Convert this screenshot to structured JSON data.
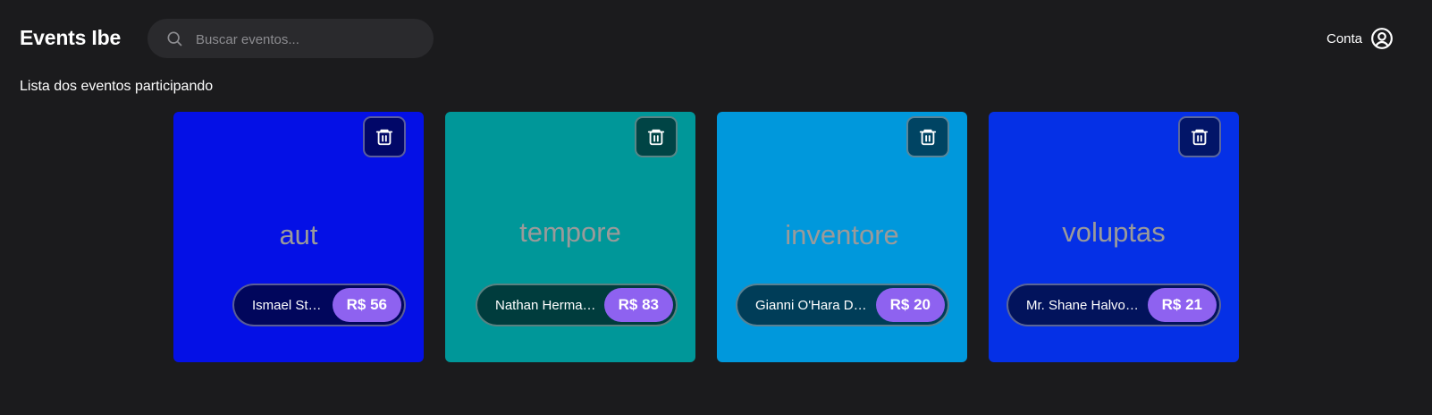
{
  "header": {
    "brand": "Events Ibe",
    "search": {
      "placeholder": "Buscar eventos...",
      "value": ""
    },
    "account_label": "Conta"
  },
  "main": {
    "subtitle": "Lista dos eventos participando"
  },
  "cards": [
    {
      "title": "aut",
      "organizer": "Ismael Stehr",
      "price": "R$ 56",
      "color": "#0410e6"
    },
    {
      "title": "tempore",
      "organizer": "Nathan Hermann",
      "price": "R$ 83",
      "color": "#009799"
    },
    {
      "title": "inventore",
      "organizer": "Gianni O'Hara DVM",
      "price": "R$ 20",
      "color": "#0098dc"
    },
    {
      "title": "voluptas",
      "organizer": "Mr. Shane Halvor...",
      "price": "R$ 21",
      "color": "#0530e6"
    }
  ],
  "icons": {
    "search": "search-icon",
    "account": "user-circle-icon",
    "delete": "trash-icon"
  },
  "colors": {
    "background": "#1b1b1d",
    "search_background": "#2a2a2d",
    "price_badge": "#8e62f0"
  }
}
